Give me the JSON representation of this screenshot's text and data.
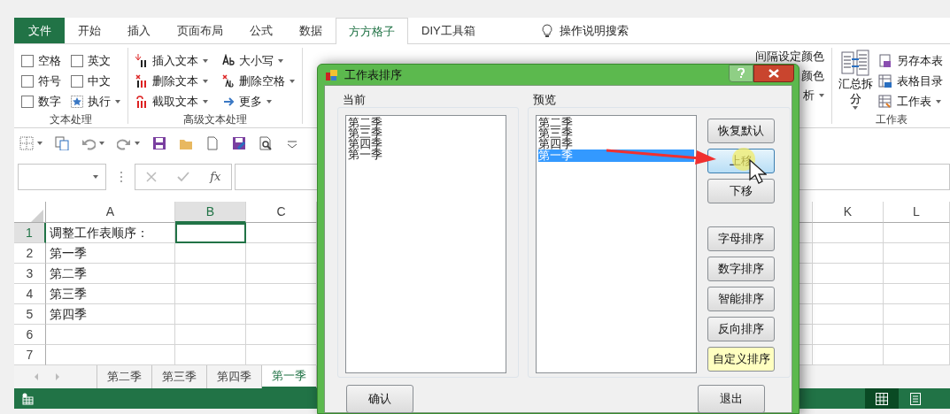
{
  "tabs": [
    {
      "label": "文件",
      "kind": "file",
      "selected": false
    },
    {
      "label": "开始",
      "kind": "tab",
      "selected": false
    },
    {
      "label": "插入",
      "kind": "tab",
      "selected": false
    },
    {
      "label": "页面布局",
      "kind": "tab",
      "selected": false
    },
    {
      "label": "公式",
      "kind": "tab",
      "selected": false
    },
    {
      "label": "数据",
      "kind": "tab",
      "selected": false
    },
    {
      "label": "方方格子",
      "kind": "tab",
      "selected": true
    },
    {
      "label": "DIY工具箱",
      "kind": "tab",
      "selected": false
    }
  ],
  "tell_me": "操作说明搜索",
  "ribbon": {
    "groups": [
      {
        "label": "文本处理",
        "items": [
          {
            "label": "空格",
            "kind": "checkbox",
            "checked": false
          },
          {
            "label": "英文",
            "kind": "checkbox",
            "checked": false
          },
          {
            "label": "符号",
            "kind": "checkbox",
            "checked": false
          },
          {
            "label": "中文",
            "kind": "checkbox",
            "checked": false
          },
          {
            "label": "数字",
            "kind": "checkbox",
            "checked": false
          },
          {
            "label": "执行",
            "kind": "dropdown"
          }
        ]
      },
      {
        "label": "高级文本处理",
        "items": [
          {
            "label": "插入文本",
            "kind": "dropdown"
          },
          {
            "label": "删除文本",
            "kind": "dropdown"
          },
          {
            "label": "截取文本",
            "kind": "dropdown"
          },
          {
            "label": "大小写",
            "kind": "dropdown"
          },
          {
            "label": "删除空格",
            "kind": "dropdown"
          },
          {
            "label": "更多",
            "kind": "dropdown"
          }
        ]
      },
      {
        "items": [
          {
            "label": "间隔设定颜色",
            "kind": "plain"
          },
          {
            "label": "颜色",
            "kind": "plain"
          },
          {
            "label": "析",
            "kind": "dropdown"
          }
        ]
      },
      {
        "label": "工作表",
        "big": {
          "label": "汇总拆分",
          "kind": "dropdown"
        },
        "items": [
          {
            "label": "另存本表",
            "kind": "plain"
          },
          {
            "label": "表格目录",
            "kind": "plain"
          },
          {
            "label": "工作表",
            "kind": "dropdown"
          }
        ]
      }
    ]
  },
  "formula_bar": {
    "function_label": "fx"
  },
  "grid": {
    "columns": [
      {
        "label": "A",
        "selected": false
      },
      {
        "label": "B",
        "selected": true
      },
      {
        "label": "C",
        "selected": false
      },
      {
        "label": "K",
        "selected": false
      },
      {
        "label": "L",
        "selected": false
      }
    ],
    "rows": [
      {
        "number": "1",
        "selected": true,
        "cells": [
          "调整工作表顺序："
        ]
      },
      {
        "number": "2",
        "selected": false,
        "cells": [
          "第一季"
        ]
      },
      {
        "number": "3",
        "selected": false,
        "cells": [
          "第二季"
        ]
      },
      {
        "number": "4",
        "selected": false,
        "cells": [
          "第三季"
        ]
      },
      {
        "number": "5",
        "selected": false,
        "cells": [
          "第四季"
        ]
      },
      {
        "number": "6",
        "selected": false,
        "cells": []
      },
      {
        "number": "7",
        "selected": false,
        "cells": []
      }
    ]
  },
  "sheet_tabs": [
    {
      "label": "第二季",
      "selected": false
    },
    {
      "label": "第三季",
      "selected": false
    },
    {
      "label": "第四季",
      "selected": false
    },
    {
      "label": "第一季",
      "selected": true
    }
  ],
  "status_bar": {
    "view_buttons": [
      {
        "kind": "normal",
        "selected": true
      },
      {
        "kind": "page_layout",
        "selected": false
      }
    ]
  },
  "dialog": {
    "title": "工作表排序",
    "current": {
      "label": "当前",
      "items": [
        "第二季",
        "第三季",
        "第四季",
        "第一季"
      ]
    },
    "preview": {
      "label": "预览",
      "items": [
        {
          "text": "第二季",
          "selected": false
        },
        {
          "text": "第三季",
          "selected": false
        },
        {
          "text": "第四季",
          "selected": false
        },
        {
          "text": "第一季",
          "selected": true
        }
      ]
    },
    "side_buttons": [
      {
        "label": "恢复默认",
        "hovered": false,
        "highlighted": false
      },
      {
        "label": "上移",
        "hovered": true,
        "highlighted": false
      },
      {
        "label": "下移",
        "hovered": false,
        "highlighted": false
      },
      {
        "label": "字母排序",
        "hovered": false,
        "highlighted": false
      },
      {
        "label": "数字排序",
        "hovered": false,
        "highlighted": false
      },
      {
        "label": "智能排序",
        "hovered": false,
        "highlighted": false
      },
      {
        "label": "反向排序",
        "hovered": false,
        "highlighted": false
      },
      {
        "label": "自定义排序",
        "hovered": false,
        "highlighted": true
      }
    ],
    "confirm_button": "确认",
    "exit_button": "退出"
  }
}
